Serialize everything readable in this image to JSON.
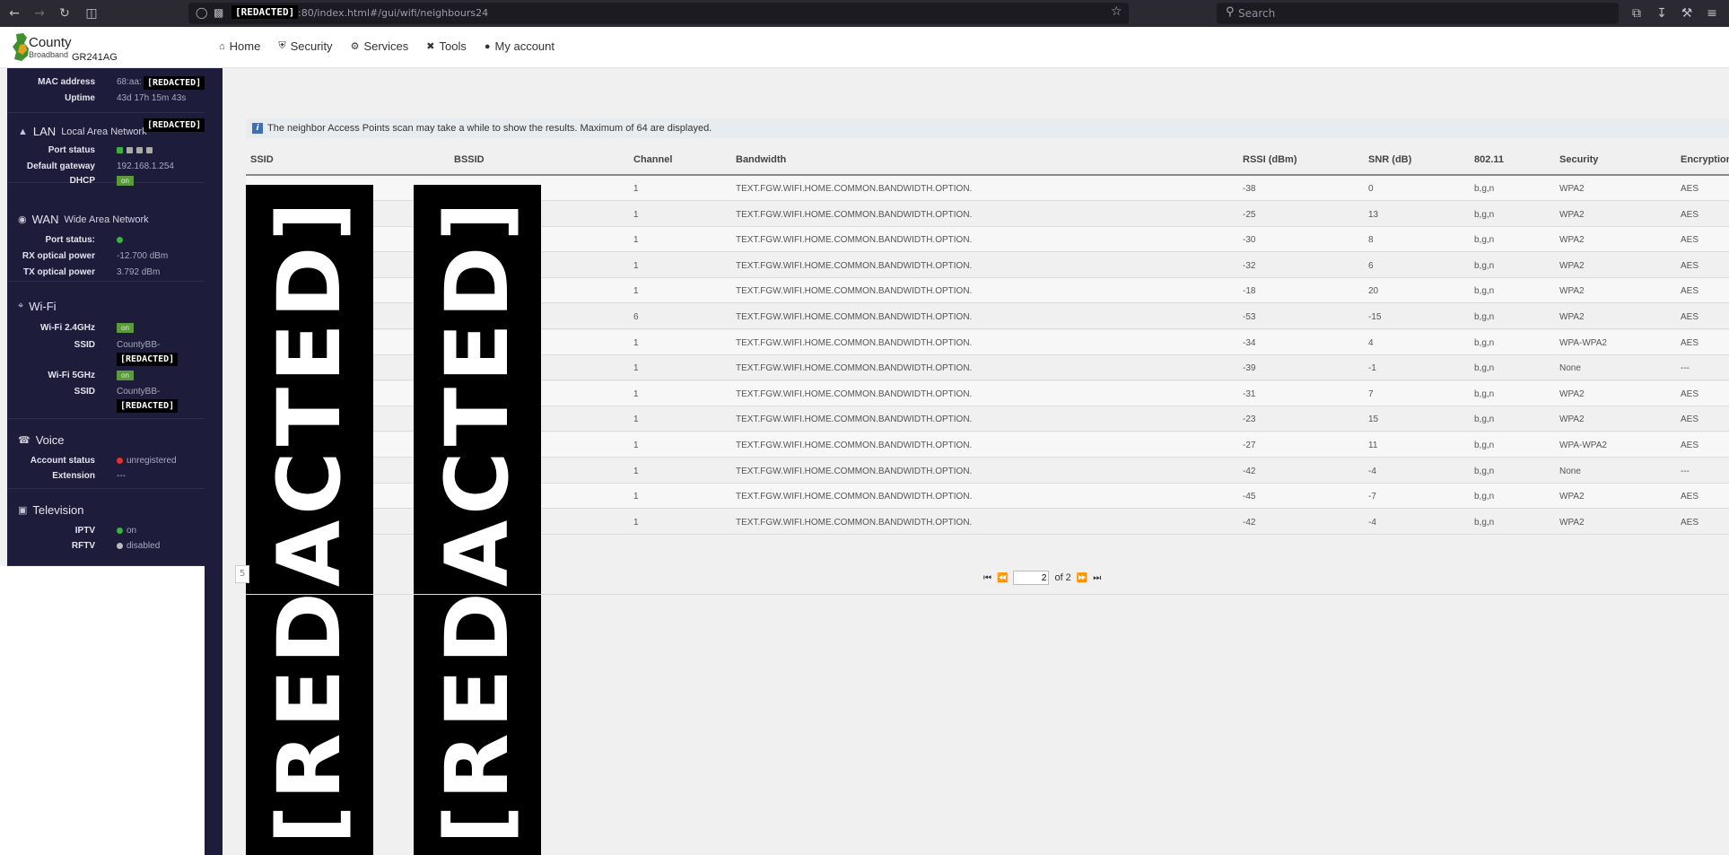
{
  "browser": {
    "url_redacted": "[REDACTED]",
    "url_path": ":80/index.html#/gui/wifi/neighbours24",
    "search_placeholder": "Search"
  },
  "app": {
    "logo_line1": "County",
    "logo_line2": "Broadband",
    "model": "GR241AG",
    "nav": [
      "Home",
      "Security",
      "Services",
      "Tools",
      "My account"
    ]
  },
  "sidebar": {
    "device": {
      "mac_label": "MAC address",
      "mac_value": "68:aa:",
      "uptime_label": "Uptime",
      "uptime_value": "43d 17h 15m 43s",
      "redacted": "[REDACTED]"
    },
    "lan": {
      "title": "LAN",
      "subtitle": "Local Area Network",
      "redacted": "[REDACTED]",
      "port_status_label": "Port status",
      "gateway_label": "Default gateway",
      "gateway_value": "192.168.1.254",
      "dhcp_label": "DHCP",
      "dhcp_value": "on"
    },
    "wan": {
      "title": "WAN",
      "subtitle": "Wide Area Network",
      "port_status_label": "Port status:",
      "rx_label": "RX optical power",
      "rx_value": "-12.700 dBm",
      "tx_label": "TX optical power",
      "tx_value": "3.792 dBm"
    },
    "wifi": {
      "title": "Wi-Fi",
      "wifi24_label": "Wi-Fi 2.4GHz",
      "wifi24_value": "on",
      "ssid24_label": "SSID",
      "ssid24_value": "CountyBB-",
      "ssid24_redacted": "[REDACTED]",
      "wifi5_label": "Wi-Fi 5GHz",
      "wifi5_value": "on",
      "ssid5_label": "SSID",
      "ssid5_value": "CountyBB-",
      "ssid5_redacted": "[REDACTED]"
    },
    "voice": {
      "title": "Voice",
      "account_label": "Account status",
      "account_value": "unregistered",
      "extension_label": "Extension",
      "extension_value": "---"
    },
    "tv": {
      "title": "Television",
      "iptv_label": "IPTV",
      "iptv_value": "on",
      "rftv_label": "RFTV",
      "rftv_value": "disabled"
    }
  },
  "main": {
    "info": "The neighbor Access Points scan may take a while to show the results. Maximum of 64 are displayed.",
    "columns": [
      "SSID",
      "BSSID",
      "Channel",
      "Bandwidth",
      "RSSI (dBm)",
      "SNR (dB)",
      "802.11",
      "Security",
      "Encryption"
    ],
    "rows": [
      {
        "channel": "1",
        "bandwidth": "TEXT.FGW.WIFI.HOME.COMMON.BANDWIDTH.OPTION.",
        "rssi": "-38",
        "snr": "0",
        "std": "b,g,n",
        "security": "WPA2",
        "enc": "AES"
      },
      {
        "channel": "1",
        "bandwidth": "TEXT.FGW.WIFI.HOME.COMMON.BANDWIDTH.OPTION.",
        "rssi": "-25",
        "snr": "13",
        "std": "b,g,n",
        "security": "WPA2",
        "enc": "AES"
      },
      {
        "channel": "1",
        "bandwidth": "TEXT.FGW.WIFI.HOME.COMMON.BANDWIDTH.OPTION.",
        "rssi": "-30",
        "snr": "8",
        "std": "b,g,n",
        "security": "WPA2",
        "enc": "AES"
      },
      {
        "channel": "1",
        "bandwidth": "TEXT.FGW.WIFI.HOME.COMMON.BANDWIDTH.OPTION.",
        "rssi": "-32",
        "snr": "6",
        "std": "b,g,n",
        "security": "WPA2",
        "enc": "AES"
      },
      {
        "channel": "1",
        "bandwidth": "TEXT.FGW.WIFI.HOME.COMMON.BANDWIDTH.OPTION.",
        "rssi": "-18",
        "snr": "20",
        "std": "b,g,n",
        "security": "WPA2",
        "enc": "AES"
      },
      {
        "channel": "6",
        "bandwidth": "TEXT.FGW.WIFI.HOME.COMMON.BANDWIDTH.OPTION.",
        "rssi": "-53",
        "snr": "-15",
        "std": "b,g,n",
        "security": "WPA2",
        "enc": "AES"
      },
      {
        "channel": "1",
        "bandwidth": "TEXT.FGW.WIFI.HOME.COMMON.BANDWIDTH.OPTION.",
        "rssi": "-34",
        "snr": "4",
        "std": "b,g,n",
        "security": "WPA-WPA2",
        "enc": "AES"
      },
      {
        "channel": "1",
        "bandwidth": "TEXT.FGW.WIFI.HOME.COMMON.BANDWIDTH.OPTION.",
        "rssi": "-39",
        "snr": "-1",
        "std": "b,g,n",
        "security": "None",
        "enc": "---"
      },
      {
        "channel": "1",
        "bandwidth": "TEXT.FGW.WIFI.HOME.COMMON.BANDWIDTH.OPTION.",
        "rssi": "-31",
        "snr": "7",
        "std": "b,g,n",
        "security": "WPA2",
        "enc": "AES"
      },
      {
        "channel": "1",
        "bandwidth": "TEXT.FGW.WIFI.HOME.COMMON.BANDWIDTH.OPTION.",
        "rssi": "-23",
        "snr": "15",
        "std": "b,g,n",
        "security": "WPA2",
        "enc": "AES"
      },
      {
        "channel": "1",
        "bandwidth": "TEXT.FGW.WIFI.HOME.COMMON.BANDWIDTH.OPTION.",
        "rssi": "-27",
        "snr": "11",
        "std": "b,g,n",
        "security": "WPA-WPA2",
        "enc": "AES"
      },
      {
        "channel": "1",
        "bandwidth": "TEXT.FGW.WIFI.HOME.COMMON.BANDWIDTH.OPTION.",
        "rssi": "-42",
        "snr": "-4",
        "std": "b,g,n",
        "security": "None",
        "enc": "---"
      },
      {
        "channel": "1",
        "bandwidth": "TEXT.FGW.WIFI.HOME.COMMON.BANDWIDTH.OPTION.",
        "rssi": "-45",
        "snr": "-7",
        "std": "b,g,n",
        "security": "WPA2",
        "enc": "AES"
      },
      {
        "channel": "1",
        "bandwidth": "TEXT.FGW.WIFI.HOME.COMMON.BANDWIDTH.OPTION.",
        "rssi": "-42",
        "snr": "-4",
        "std": "b,g,n",
        "security": "WPA2",
        "enc": "AES"
      }
    ],
    "redacted": "[REDACTED]",
    "pager": {
      "page": "2",
      "of_text": "of 2",
      "pagesize_fragment": "5"
    }
  }
}
